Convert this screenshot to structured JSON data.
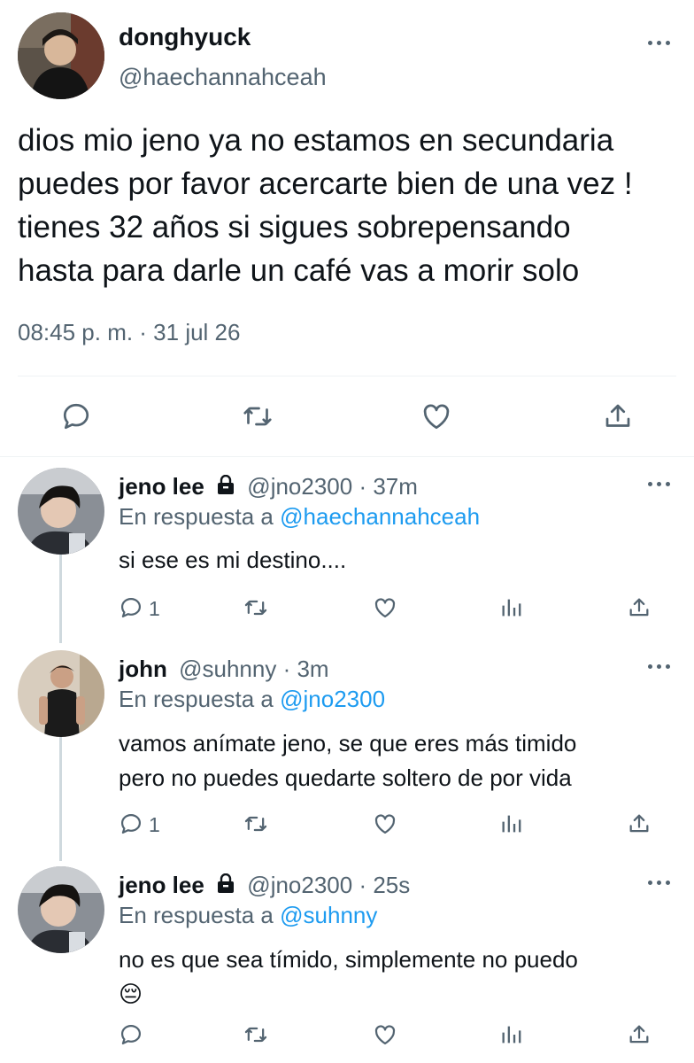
{
  "main_tweet": {
    "display_name": "donghyuck",
    "handle": "@haechannahceah",
    "text_lines": [
      "dios mio jeno ya no estamos en secundaria",
      "puedes por favor acercarte bien de una vez !",
      "tienes 32 años si sigues sobrepensando",
      "hasta para darle un café vas a morir solo"
    ],
    "timestamp": "08:45 p. m. · 31 jul 26"
  },
  "replies": [
    {
      "display_name": "jeno lee",
      "handle_time": "@jno2300 · 37m",
      "reply_prefix": "En respuesta a",
      "reply_to": "@haechannahceah",
      "text_lines": [
        "si ese es mi destino...."
      ],
      "reply_count": "1"
    },
    {
      "display_name": "john",
      "handle_time": "@suhnny · 3m",
      "reply_prefix": "En respuesta a",
      "reply_to": "@jno2300",
      "text_lines": [
        "vamos anímate jeno, se que eres más timido",
        "pero no puedes quedarte soltero de por vida"
      ],
      "reply_count": "1"
    },
    {
      "display_name": "jeno lee",
      "handle_time": "@jno2300 · 25s",
      "reply_prefix": "En respuesta a",
      "reply_to": "@suhnny",
      "text_lines": [
        "no es que sea tímido, simplemente no puedo"
      ],
      "emoji": "😔",
      "reply_count": ""
    }
  ],
  "icons": [
    "more-icon",
    "reply-icon",
    "retweet-icon",
    "like-icon",
    "share-icon",
    "analytics-icon",
    "lock-icon"
  ],
  "colors": {
    "text": "#0f1419",
    "secondary": "#536471",
    "link": "#1d9bf0",
    "divider": "#eff3f4"
  }
}
